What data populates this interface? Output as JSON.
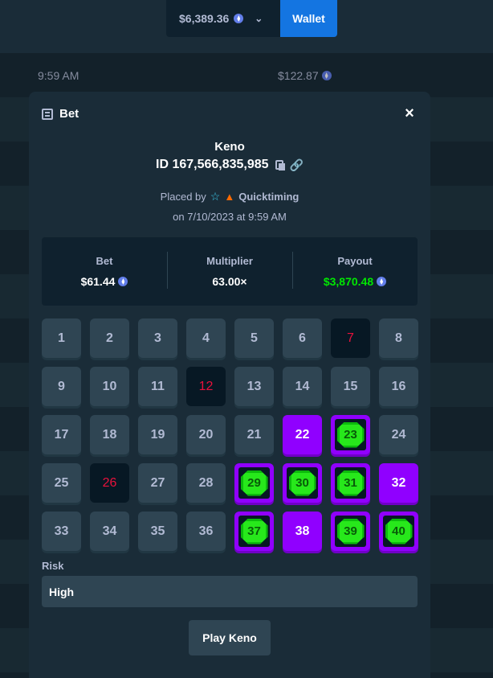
{
  "header": {
    "balance": "$6,389.36",
    "balance_currency_icon": "eth-icon",
    "wallet_label": "Wallet"
  },
  "background_row": {
    "time": "9:59 AM",
    "amount": "$122.87"
  },
  "modal": {
    "title": "Bet",
    "close_icon": "×",
    "game": "Keno",
    "bet_id": "ID 167,566,835,985",
    "placed_by_label": "Placed by",
    "username": "Quicktiming",
    "placed_on": "on 7/10/2023 at 9:59 AM",
    "stats": {
      "bet_label": "Bet",
      "bet_value": "$61.44",
      "multiplier_label": "Multiplier",
      "multiplier_value": "63.00×",
      "payout_label": "Payout",
      "payout_value": "$3,870.48"
    },
    "tiles": [
      {
        "n": "1",
        "s": "normal"
      },
      {
        "n": "2",
        "s": "normal"
      },
      {
        "n": "3",
        "s": "normal"
      },
      {
        "n": "4",
        "s": "normal"
      },
      {
        "n": "5",
        "s": "normal"
      },
      {
        "n": "6",
        "s": "normal"
      },
      {
        "n": "7",
        "s": "miss"
      },
      {
        "n": "8",
        "s": "normal"
      },
      {
        "n": "9",
        "s": "normal"
      },
      {
        "n": "10",
        "s": "normal"
      },
      {
        "n": "11",
        "s": "normal"
      },
      {
        "n": "12",
        "s": "miss"
      },
      {
        "n": "13",
        "s": "normal"
      },
      {
        "n": "14",
        "s": "normal"
      },
      {
        "n": "15",
        "s": "normal"
      },
      {
        "n": "16",
        "s": "normal"
      },
      {
        "n": "17",
        "s": "normal"
      },
      {
        "n": "18",
        "s": "normal"
      },
      {
        "n": "19",
        "s": "normal"
      },
      {
        "n": "20",
        "s": "normal"
      },
      {
        "n": "21",
        "s": "normal"
      },
      {
        "n": "22",
        "s": "picked"
      },
      {
        "n": "23",
        "s": "hit"
      },
      {
        "n": "24",
        "s": "normal"
      },
      {
        "n": "25",
        "s": "normal"
      },
      {
        "n": "26",
        "s": "miss"
      },
      {
        "n": "27",
        "s": "normal"
      },
      {
        "n": "28",
        "s": "normal"
      },
      {
        "n": "29",
        "s": "hit"
      },
      {
        "n": "30",
        "s": "hit"
      },
      {
        "n": "31",
        "s": "hit"
      },
      {
        "n": "32",
        "s": "picked"
      },
      {
        "n": "33",
        "s": "normal"
      },
      {
        "n": "34",
        "s": "normal"
      },
      {
        "n": "35",
        "s": "normal"
      },
      {
        "n": "36",
        "s": "normal"
      },
      {
        "n": "37",
        "s": "hit"
      },
      {
        "n": "38",
        "s": "picked"
      },
      {
        "n": "39",
        "s": "hit"
      },
      {
        "n": "40",
        "s": "hit"
      }
    ],
    "risk_label": "Risk",
    "risk_value": "High",
    "play_button": "Play Keno"
  },
  "colors": {
    "accent_purple": "#9000ff",
    "payout_green": "#00e701",
    "miss_red": "#e9113c",
    "wallet_blue": "#1475e1"
  }
}
